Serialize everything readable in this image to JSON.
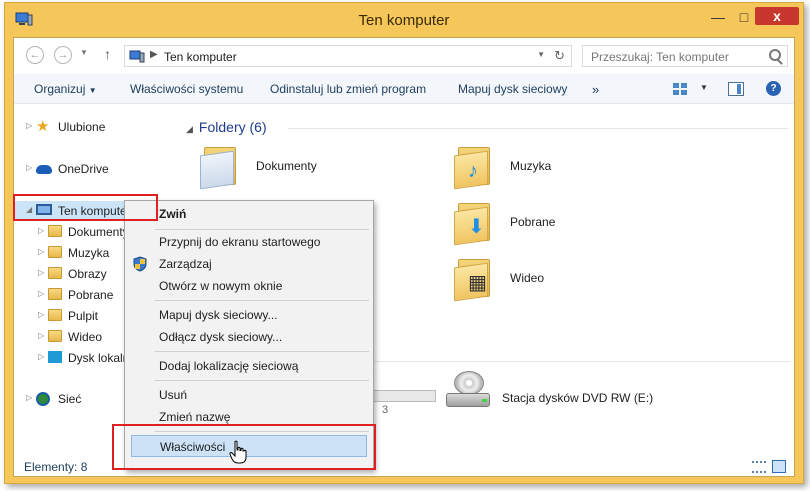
{
  "window": {
    "title": "Ten komputer",
    "close_label": "x",
    "min_label": "—",
    "max_label": "□"
  },
  "address": {
    "path": "Ten komputer",
    "search_placeholder": "Przeszukaj: Ten komputer"
  },
  "toolbar": {
    "organize": "Organizuj",
    "sysprops": "Właściwości systemu",
    "uninstall": "Odinstaluj lub zmień program",
    "mapdrive": "Mapuj dysk sieciowy",
    "more": "»"
  },
  "nav": {
    "favorites": "Ulubione",
    "onedrive": "OneDrive",
    "thispc": "Ten komputer",
    "items": [
      "Dokumenty",
      "Muzyka",
      "Obrazy",
      "Pobrane",
      "Pulpit",
      "Wideo",
      "Dysk lokalny"
    ],
    "network": "Sieć"
  },
  "main": {
    "group_header": "Foldery (6)",
    "folders": [
      "Dokumenty",
      "Muzyka",
      "Pobrane",
      "Wideo"
    ],
    "drive_label": "Stacja dysków DVD RW (E:)",
    "drive_bar_text": "3"
  },
  "status": {
    "count": "Elementy: 8"
  },
  "context_menu": {
    "collapse": "Zwiń",
    "pin": "Przypnij do ekranu startowego",
    "manage": "Zarządzaj",
    "open_new": "Otwórz w nowym oknie",
    "map_drive": "Mapuj dysk sieciowy...",
    "disconnect": "Odłącz dysk sieciowy...",
    "add_location": "Dodaj lokalizację sieciową",
    "delete": "Usuń",
    "rename": "Zmień nazwę",
    "properties": "Właściwości"
  },
  "colors": {
    "frame": "#f5c75a",
    "highlight": "#cde2f7",
    "annotation": "#e02020"
  }
}
